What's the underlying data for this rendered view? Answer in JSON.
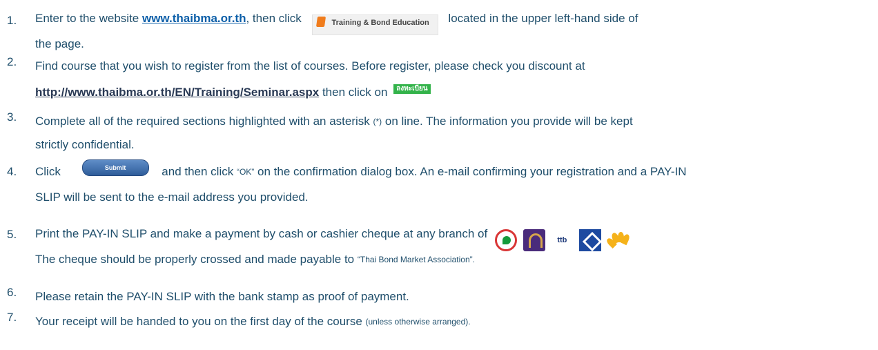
{
  "steps": [
    {
      "num": "1.",
      "lines": [
        [
          "Enter to the website ",
          "www.thaibma.or.th",
          ", then click ",
          "Training & Bond Education",
          " located in the upper left-hand side of"
        ],
        [
          "the page."
        ]
      ]
    },
    {
      "num": "2.",
      "lines": [
        [
          "Find course that you wish to register from the list of courses. Before register, please check you discount at"
        ],
        [
          "http://www.thaibma.or.th/EN/Training/Seminar.aspx",
          " then click on ",
          "ลงทะเบียน"
        ]
      ]
    },
    {
      "num": "3.",
      "lines": [
        [
          "Complete all of the required sections highlighted with an asterisk ",
          "(*)",
          " on line. The information you provide will be kept"
        ],
        [
          "strictly confidential."
        ]
      ]
    },
    {
      "num": "4.",
      "lines": [
        [
          "Click ",
          "Submit",
          " and then click ",
          "“OK”",
          " on the confirmation dialog box. An e-mail confirming your registration and a PAY-IN"
        ],
        [
          "SLIP will be sent to the e-mail address you provided."
        ]
      ]
    },
    {
      "num": "5.",
      "lines": [
        [
          "Print the PAY-IN SLIP and make a payment by cash or cashier cheque at any branch of "
        ],
        [
          "The cheque should be properly crossed and made payable to ",
          "“Thai Bond Market Association”."
        ]
      ]
    },
    {
      "num": "6.",
      "lines": [
        [
          "Please retain the PAY-IN SLIP with the bank stamp as proof of payment."
        ]
      ]
    },
    {
      "num": "7.",
      "lines": [
        [
          "Your receipt will be handed to you on the first day of the course ",
          "(unless otherwise arranged)."
        ]
      ]
    }
  ],
  "banks": [
    "kasikorn-bank-logo",
    "scb-logo",
    "ttb-logo",
    "bangkok-bank-logo",
    "krungthai-bank-logo"
  ],
  "bank_texts": {
    "ttb": "ttb"
  },
  "colors": {
    "text": "#1f4e6b",
    "link": "#0b5ea8",
    "register_button": "#33b34a",
    "training_icon": "#f07c1c"
  }
}
